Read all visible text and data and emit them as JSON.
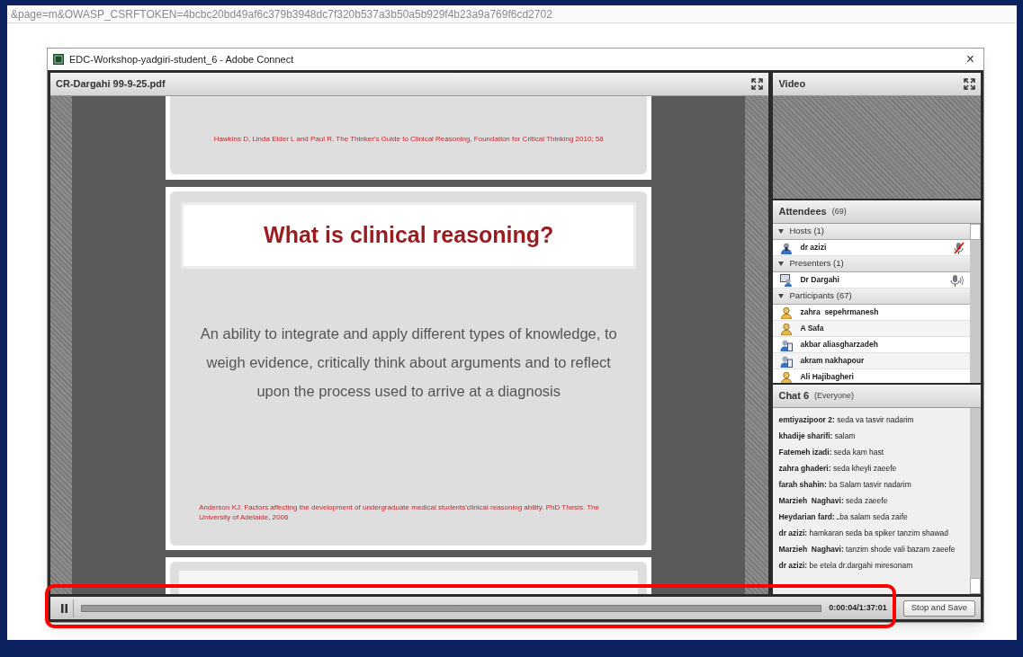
{
  "browser": {
    "url": "&page=m&OWASP_CSRFTOKEN=4bcbc20bd49af6c379b3948dc7f320b537a3b50a5b929f4b23a9a769f6cd2702"
  },
  "window": {
    "title": "EDC-Workshop-yadgiri-student_6 - Adobe Connect",
    "close": "×"
  },
  "share_pod": {
    "title": "CR-Dargahi 99-9-25.pdf",
    "slides": [
      {
        "kind": "citation",
        "citation": "Hawkins D, Linda Elder  L and Paul R. The Thinker's Guide to Clinical Reasoning, Foundation for Critical Thinking 2010; 58"
      },
      {
        "kind": "full",
        "heading": "What is clinical reasoning?",
        "body": "An ability to integrate and apply different types of knowledge, to weigh evidence, critically think about arguments and to reflect upon the process used to arrive at a diagnosis",
        "citation": "Anderson KJ. Factors affecting the development of undergraduate medical students'clinical reasoning ability. PhD Thesis. The University of Adelaide, 2006"
      },
      {
        "kind": "blank"
      }
    ]
  },
  "video_pod": {
    "title": "Video"
  },
  "attendees_pod": {
    "title": "Attendees",
    "count": "(69)",
    "groups": [
      {
        "label": "Hosts (1)",
        "expanded": true,
        "people": [
          {
            "name": "dr azizi",
            "kind": "host",
            "mic_on": false
          }
        ]
      },
      {
        "label": "Presenters (1)",
        "expanded": true,
        "people": [
          {
            "name": "Dr Dargahi",
            "kind": "presenter",
            "mic_on": true
          }
        ]
      },
      {
        "label": "Participants (67)",
        "expanded": true,
        "people": [
          {
            "name": "zahra  sepehrmanesh",
            "kind": "participant"
          },
          {
            "name": "A Safa",
            "kind": "participant"
          },
          {
            "name": "akbar aliasgharzadeh",
            "kind": "mobile"
          },
          {
            "name": "akram nakhapour",
            "kind": "mobile"
          },
          {
            "name": "Ali Hajibagheri",
            "kind": "participant"
          }
        ]
      }
    ]
  },
  "chat_pod": {
    "title": "Chat 6",
    "audience": "(Everyone)",
    "messages": [
      "**emtiyazipoor 2:** seda va tasvir nadarim",
      "**khadije sharifi:** salam",
      "**Fatemeh izadi:** seda kam hast",
      "**zahra ghaderi:** seda kheyli zaeefe",
      "**farah shahin:** ba Salam tasvir nadarim",
      "**Marzieh  Naghavi:** seda zaeefe",
      "**Heydarian fard:** ـba salam seda zaife",
      "**dr azizi:** hamkaran seda ba spiker tanzim shawad",
      "**Marzieh  Naghavi:** tanzim shode vali bazam zaeefe",
      "**dr azizi:** be etela dr.dargahi miresonam"
    ]
  },
  "playback": {
    "playing": true,
    "time": "0:00:04/1:37:01",
    "stop_button": "Stop and Save"
  }
}
